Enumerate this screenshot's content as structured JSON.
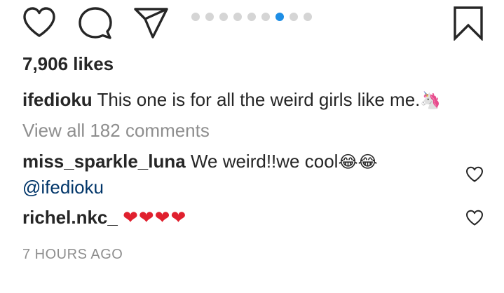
{
  "actions": {
    "like_icon": "heart-outline-icon",
    "comment_icon": "comment-bubble-icon",
    "share_icon": "paper-plane-icon",
    "save_icon": "bookmark-icon"
  },
  "carousel": {
    "total": 9,
    "active_index": 6,
    "active_color": "#1e8ee5",
    "inactive_color": "#d5d5d5"
  },
  "post": {
    "likes": "7,906 likes",
    "caption_user": "ifedioku",
    "caption_text": "This one is for all the weird girls like me.",
    "caption_emoji": "🦄",
    "view_comments": "View all 182 comments",
    "timestamp": "7 HOURS AGO"
  },
  "comments": [
    {
      "user": "miss_sparkle_luna",
      "text": "We weird!!we cool",
      "emoji": "😂😂",
      "mention": "@ifedioku",
      "like_icon": "heart-outline-icon"
    },
    {
      "user": "richel.nkc_",
      "text": "",
      "emoji": "❤❤❤❤",
      "like_icon": "heart-outline-icon"
    }
  ],
  "colors": {
    "text": "#262626",
    "secondary": "#8e8e8e",
    "mention": "#003569",
    "heart_red": "#e0202e"
  }
}
